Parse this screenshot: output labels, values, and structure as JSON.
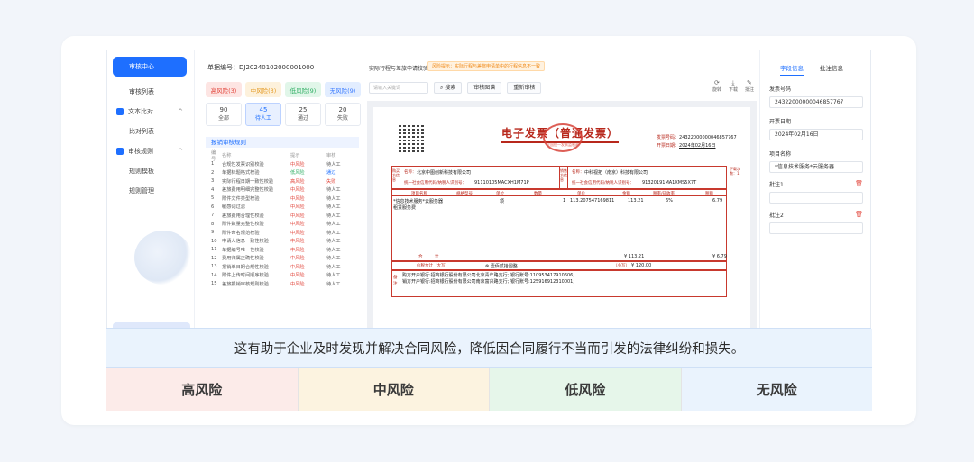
{
  "sidebar": {
    "items": [
      {
        "label": "审核中心",
        "active": true
      },
      {
        "label": "审核列表"
      },
      {
        "label": "文本比对",
        "group": true
      },
      {
        "label": "比对列表"
      },
      {
        "label": "审核规则",
        "group": true
      },
      {
        "label": "规则模板"
      },
      {
        "label": "规则管理"
      }
    ]
  },
  "bill": {
    "label": "单据编号：",
    "value": "DJ20240102000001000"
  },
  "risk_tabs": [
    "高风险(3)",
    "中风险(3)",
    "低风险(9)",
    "无风险(9)"
  ],
  "stats": [
    {
      "count": "90",
      "label": "全部"
    },
    {
      "count": "45",
      "label": "待人工",
      "selected": true
    },
    {
      "count": "25",
      "label": "通过"
    },
    {
      "count": "20",
      "label": "失败"
    }
  ],
  "rules": {
    "title": "报销审核规则",
    "headers": [
      "编号",
      "名称",
      "提示",
      "审核"
    ],
    "rows": [
      [
        "1",
        "合规性发票识别校验",
        "中风险",
        "待人工"
      ],
      [
        "2",
        "单据标题格式校验",
        "低风险",
        "通过"
      ],
      [
        "3",
        "实际行程日期一致性校验",
        "高风险",
        "失败"
      ],
      [
        "4",
        "差旅费用明细完整性校验",
        "中风险",
        "待人工"
      ],
      [
        "5",
        "附件文件类型校验",
        "中风险",
        "待人工"
      ],
      [
        "6",
        "敏感词过滤",
        "中风险",
        "待人工"
      ],
      [
        "7",
        "差旅费用合理性校验",
        "中风险",
        "待人工"
      ],
      [
        "8",
        "附件数量完整性校验",
        "中风险",
        "待人工"
      ],
      [
        "9",
        "附件命名规范校验",
        "中风险",
        "待人工"
      ],
      [
        "10",
        "申请人信息一致性校验",
        "中风险",
        "待人工"
      ],
      [
        "11",
        "单据编号唯一性校验",
        "中风险",
        "待人工"
      ],
      [
        "12",
        "费用归属正确性校验",
        "中风险",
        "待人工"
      ],
      [
        "13",
        "报销单日期合规性校验",
        "中风险",
        "待人工"
      ],
      [
        "14",
        "附件上传时间顺序校验",
        "中风险",
        "待人工"
      ],
      [
        "15",
        "差旅报销审核规则校验",
        "中风险",
        "待人工"
      ]
    ]
  },
  "doc": {
    "title": "实际行程与差旅申请校验",
    "warning": "风险提示：实际行程与差旅申请单中的行程信息不一致",
    "search_placeholder": "请输入关键词",
    "buttons": [
      "搜索",
      "审核图谱",
      "重新审核"
    ],
    "icons": [
      "旋转",
      "下载",
      "批注"
    ]
  },
  "invoice": {
    "title": "电子发票（普通发票）",
    "seal_text": "全国统一发票监制章",
    "number_label": "发票号码：",
    "number": "24322000000046857767",
    "date_label": "开票日期：",
    "date": "2024年02月16日",
    "buyer_name_label": "名称：",
    "buyer_name": "北京中图创新科技有限公司",
    "buyer_tax_label": "统一社会信用代码/纳税人识别号：",
    "buyer_tax": "91110105MACXH1M71P",
    "seller_name": "中科视拓（南京）科技有限公司",
    "seller_tax": "91320191MA1XMS5X7T",
    "buyer_side": "购买方信息",
    "seller_side": "销售方信息",
    "remark_side": "下载次数：1",
    "item_headers": [
      "项目名称",
      "规格型号",
      "单位",
      "数量",
      "单价",
      "金额",
      "税率/征收率",
      "税额"
    ],
    "item_name": "*信息技术服务*云服务器",
    "item_sub": "租赁服务费",
    "unit": "项",
    "qty": "1",
    "price": "113.207547169811",
    "amount": "113.21",
    "rate": "6%",
    "tax": "6.79",
    "total_label": "合　　　计",
    "total_amount": "¥ 113.21",
    "total_tax": "¥ 6.79",
    "cap_label": "价税合计（大写）",
    "cap_value": "壹佰贰拾圆整",
    "small_label": "（小写）",
    "small_value": "¥ 120.00",
    "remark_label": "备注",
    "remark1": "购方开户银行:招商银行股份有限公司北京青年路支行; 银行账号:110953417910606;",
    "remark2": "销方开户银行:招商银行股份有限公司南京富兴路支行; 银行账号:125916912310001;"
  },
  "right_panel": {
    "tabs": [
      "字段信息",
      "批注信息"
    ],
    "fields": [
      {
        "label": "发票号码",
        "value": "24322000000046857767"
      },
      {
        "label": "开票日期",
        "value": "2024年02月16日"
      },
      {
        "label": "项目名称",
        "value": "*信息技术服务*云服务器"
      }
    ],
    "annotations": [
      "批注1",
      "批注2"
    ]
  },
  "caption": "这有助于企业及时发现并解决合同风险，降低因合同履行不当而引发的法律纠纷和损失。",
  "levels": [
    "高风险",
    "中风险",
    "低风险",
    "无风险"
  ]
}
